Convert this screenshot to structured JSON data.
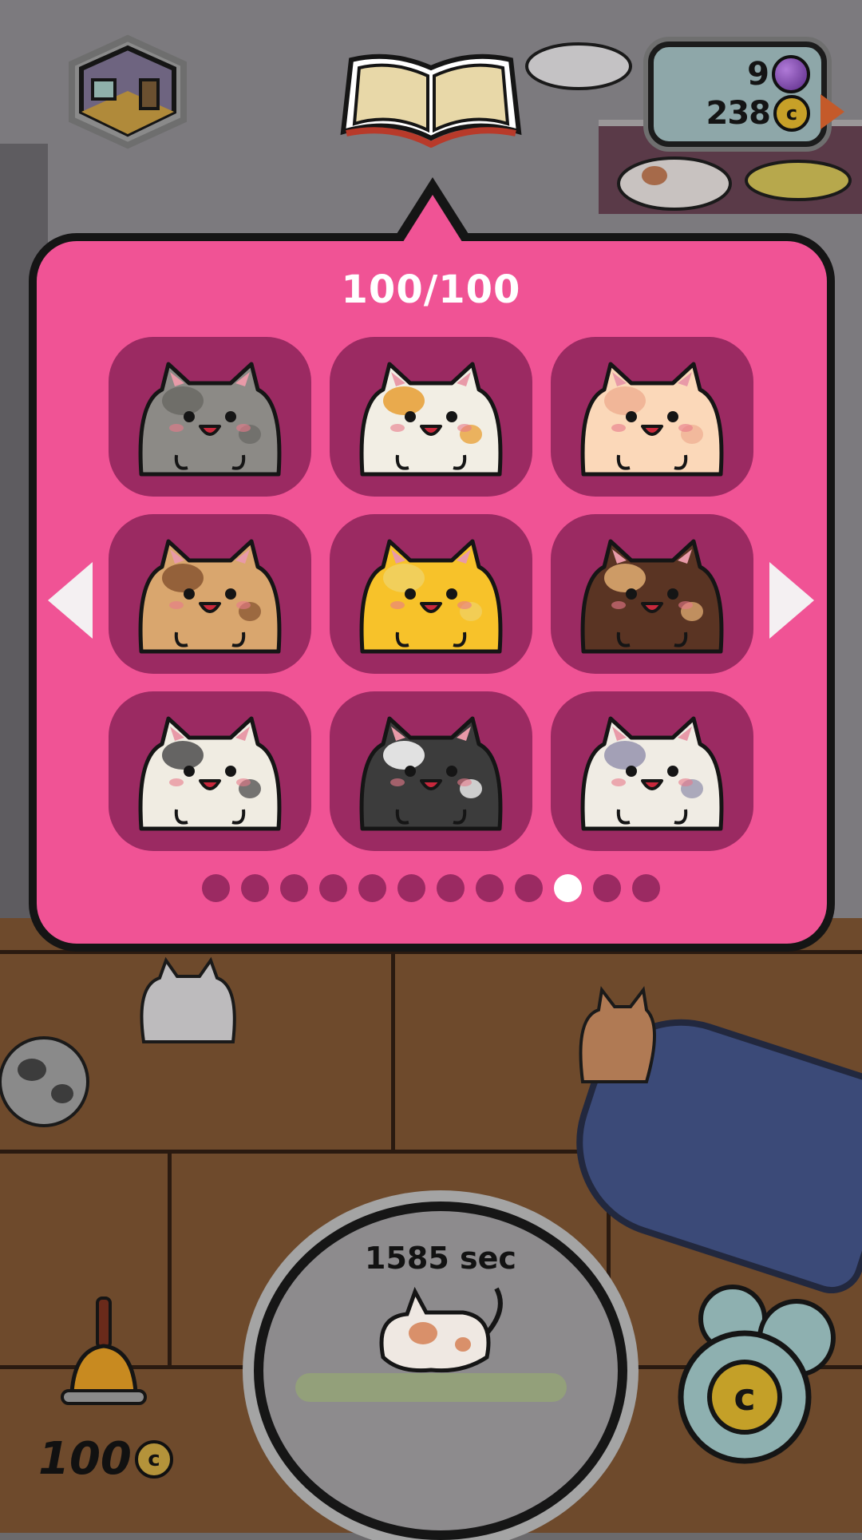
{
  "hud": {
    "gems": "9",
    "coins": "238",
    "bell_price": "100",
    "timer_text": "1585 sec",
    "coin_symbol": "c"
  },
  "popup": {
    "count_text": "100/100",
    "current_page": 10,
    "total_pages": 12,
    "cats": [
      {
        "name": "grey-tabby",
        "icon": "cat-icon",
        "body": "#8c8a86",
        "spot": "#6b6a66"
      },
      {
        "name": "calico-white",
        "icon": "cat-icon",
        "body": "#f2eee4",
        "spot": "#e8a23c"
      },
      {
        "name": "peach",
        "icon": "cat-icon",
        "body": "#fbd8b9",
        "spot": "#f0b295"
      },
      {
        "name": "brown-white",
        "icon": "cat-icon",
        "body": "#d9a66e",
        "spot": "#8c5a34"
      },
      {
        "name": "golden-lucky",
        "icon": "cat-icon",
        "body": "#f7c22a",
        "spot": "#f0d060"
      },
      {
        "name": "chocolate-spotted",
        "icon": "cat-icon",
        "body": "#5a3423",
        "spot": "#d9a66e"
      },
      {
        "name": "white-striped",
        "icon": "cat-icon",
        "body": "#f0ece2",
        "spot": "#555555"
      },
      {
        "name": "tuxedo",
        "icon": "cat-icon",
        "body": "#3c3c3c",
        "spot": "#f3f3f3"
      },
      {
        "name": "white-lilac",
        "icon": "cat-icon",
        "body": "#f0ece4",
        "spot": "#9a98b0"
      }
    ]
  },
  "colors": {
    "popup_bg": "#f05395",
    "cell_bg": "#9b2a62",
    "dot_active": "#ffffff",
    "dot_inactive": "#9b2a62"
  }
}
